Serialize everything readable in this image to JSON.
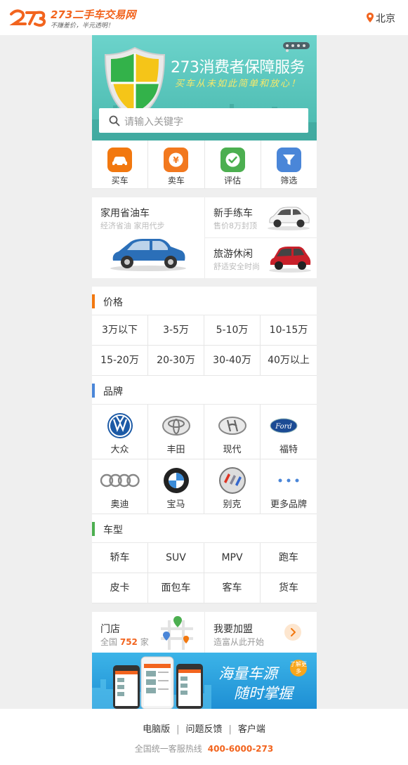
{
  "header": {
    "logo_title": "273二手车交易网",
    "logo_slogan": "不赚差价，半元透明！",
    "city": "北京"
  },
  "banner": {
    "title": "273消费者保障服务",
    "slogan": "买车从未如此简单和放心！"
  },
  "search": {
    "placeholder": "请输入关键字"
  },
  "quick_nav": [
    {
      "label": "买车",
      "icon": "car-icon",
      "color": "#f2780f"
    },
    {
      "label": "卖车",
      "icon": "yen-icon",
      "color": "#f2781e"
    },
    {
      "label": "评估",
      "icon": "check-icon",
      "color": "#4caf50"
    },
    {
      "label": "筛选",
      "icon": "filter-icon",
      "color": "#4a86d8"
    }
  ],
  "recommend": {
    "main": {
      "title": "家用省油车",
      "subtitle": "经济省油 家用代步"
    },
    "items": [
      {
        "title": "新手练车",
        "subtitle": "售价8万封顶"
      },
      {
        "title": "旅游休闲",
        "subtitle": "舒适安全时尚"
      }
    ]
  },
  "price": {
    "title": "价格",
    "accent": "#f2780f",
    "options": [
      "3万以下",
      "3-5万",
      "5-10万",
      "10-15万",
      "15-20万",
      "20-30万",
      "30-40万",
      "40万以上"
    ]
  },
  "brand": {
    "title": "品牌",
    "accent": "#4a86d8",
    "items": [
      {
        "label": "大众",
        "icon": "volkswagen-logo-icon"
      },
      {
        "label": "丰田",
        "icon": "toyota-logo-icon"
      },
      {
        "label": "现代",
        "icon": "hyundai-logo-icon"
      },
      {
        "label": "福特",
        "icon": "ford-logo-icon"
      },
      {
        "label": "奥迪",
        "icon": "audi-logo-icon"
      },
      {
        "label": "宝马",
        "icon": "bmw-logo-icon"
      },
      {
        "label": "别克",
        "icon": "buick-logo-icon"
      },
      {
        "label": "更多品牌",
        "icon": "more-dots-icon"
      }
    ]
  },
  "vehicle_type": {
    "title": "车型",
    "accent": "#4caf50",
    "options": [
      "轿车",
      "SUV",
      "MPV",
      "跑车",
      "皮卡",
      "面包车",
      "客车",
      "货车"
    ]
  },
  "store": {
    "title": "门店",
    "count_prefix": "全国",
    "count": "752",
    "count_suffix": "家",
    "join_title": "我要加盟",
    "join_subtitle": "造富从此开始"
  },
  "ad": {
    "line1": "海量车源",
    "line2": "随时掌握",
    "badge": "了解更多"
  },
  "footer": {
    "links": [
      "电脑版",
      "问题反馈",
      "客户端"
    ],
    "hotline_label": "全国统一客服热线",
    "hotline_number": "400-6000-273"
  }
}
